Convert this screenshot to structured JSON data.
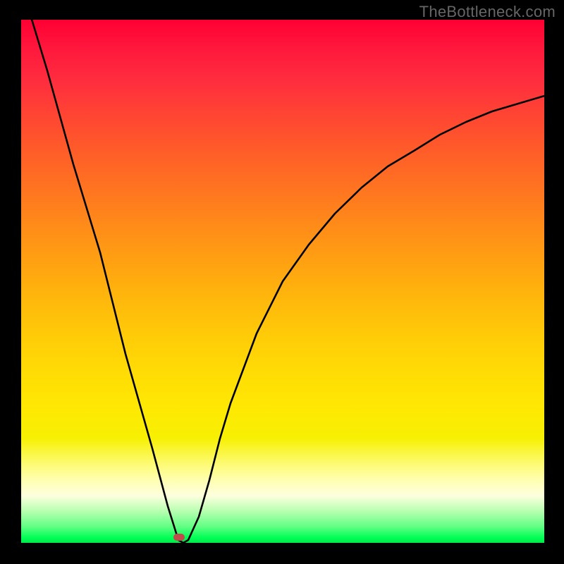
{
  "watermark": "TheBottleneck.com",
  "chart_data": {
    "type": "line",
    "title": "",
    "xlabel": "",
    "ylabel": "",
    "xlim": [
      0,
      100
    ],
    "ylim": [
      0,
      100
    ],
    "background": "green-to-red vertical gradient (green at bottom = optimal, red at top = bottleneck)",
    "series": [
      {
        "name": "bottleneck-curve",
        "x": [
          0,
          5,
          10,
          15,
          20,
          25,
          28,
          30,
          31,
          32,
          34,
          36,
          38,
          40,
          45,
          50,
          55,
          60,
          65,
          70,
          75,
          80,
          85,
          90,
          95,
          100
        ],
        "values": [
          107,
          89,
          71,
          54,
          36,
          18,
          7,
          0.5,
          0,
          0.5,
          5,
          12,
          20,
          27,
          40,
          50,
          57,
          63,
          68,
          72,
          75,
          78,
          80.5,
          82.5,
          84,
          85.5
        ]
      }
    ],
    "marker": {
      "x": 31,
      "y": 0,
      "color": "#c14b4b",
      "meaning": "optimal balance point"
    },
    "colors": {
      "curve": "#000000",
      "top": "#ff0033",
      "mid": "#ffd400",
      "bottom": "#00ff55",
      "frame": "#000000"
    }
  }
}
